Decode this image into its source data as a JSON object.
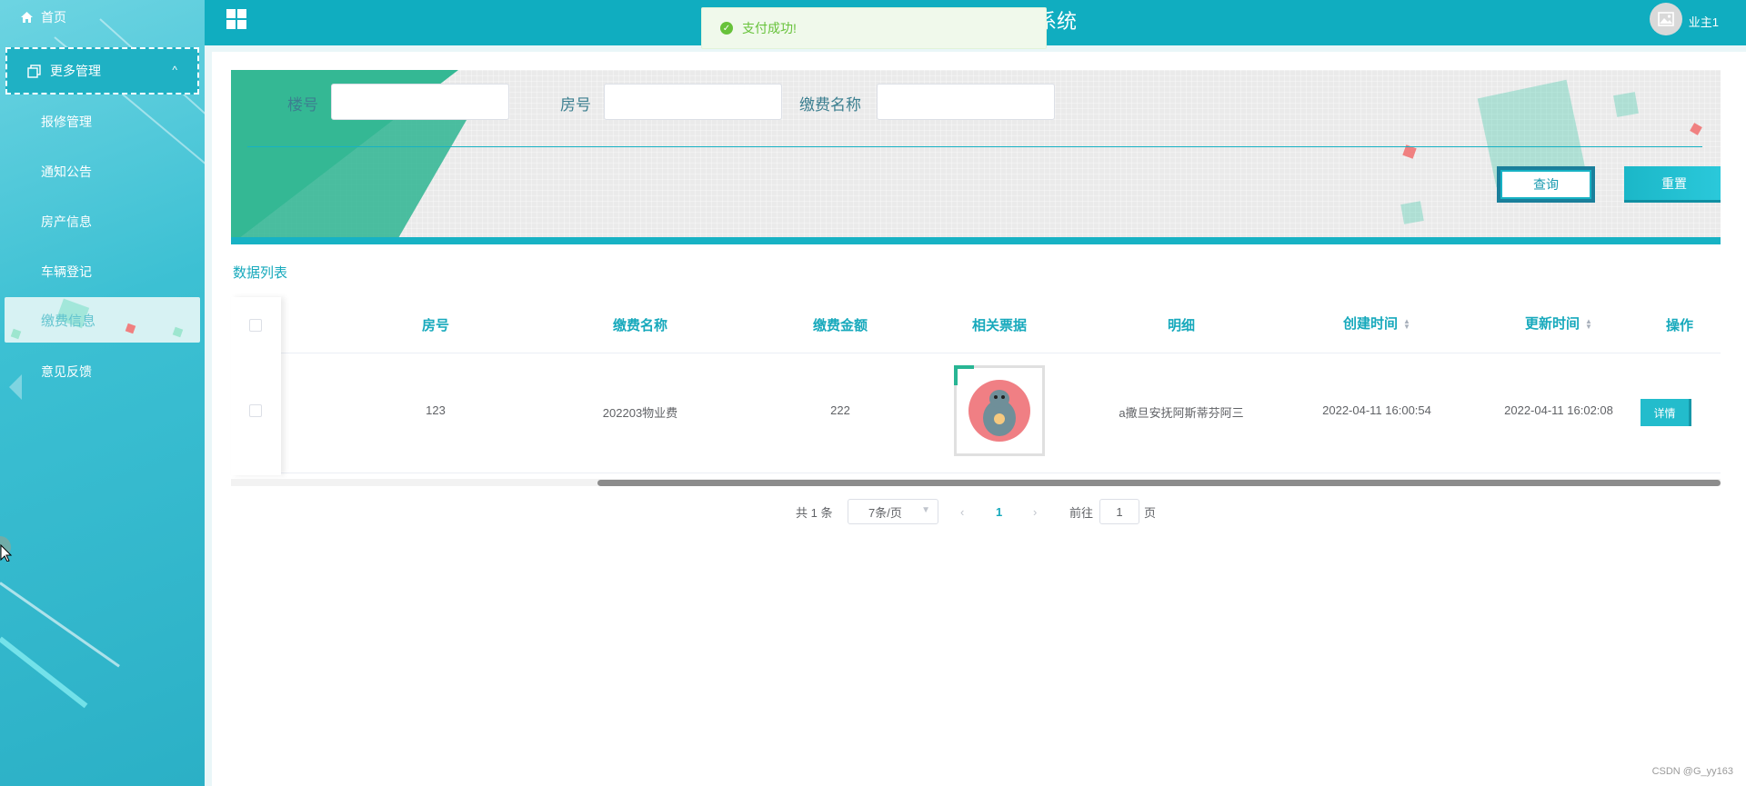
{
  "sidebar": {
    "home_label": "首页",
    "group_label": "更多管理",
    "items": [
      {
        "label": "报修管理"
      },
      {
        "label": "通知公告"
      },
      {
        "label": "房产信息"
      },
      {
        "label": "车辆登记"
      },
      {
        "label": "缴费信息"
      },
      {
        "label": "意见反馈"
      }
    ],
    "active_item": "缴费信息"
  },
  "header": {
    "title": "系统",
    "user_name": "业主1"
  },
  "toast": {
    "message": "支付成功!"
  },
  "search": {
    "fields": [
      {
        "label": "楼号",
        "value": ""
      },
      {
        "label": "房号",
        "value": ""
      },
      {
        "label": "缴费名称",
        "value": ""
      }
    ],
    "query_label": "查询",
    "reset_label": "重置"
  },
  "list": {
    "title": "数据列表",
    "columns": [
      "房号",
      "缴费名称",
      "缴费金额",
      "相关票据",
      "明细",
      "创建时间",
      "更新时间",
      "操作"
    ],
    "rows": [
      {
        "room": "123",
        "fee_name": "202203物业费",
        "amount": "222",
        "detail": "a撒旦安抚阿斯蒂芬阿三",
        "created": "2022-04-11 16:00:54",
        "updated": "2022-04-11 16:02:08",
        "action": "详情"
      }
    ]
  },
  "pagination": {
    "total_text": "共 1 条",
    "page_size": "7条/页",
    "current_page": "1",
    "goto_prefix": "前往",
    "goto_value": "1",
    "goto_suffix": "页"
  },
  "watermark": "CSDN @G_yy163",
  "colors": {
    "accent": "#17b2c4",
    "header": "#10adc0",
    "success": "#67c23a"
  }
}
